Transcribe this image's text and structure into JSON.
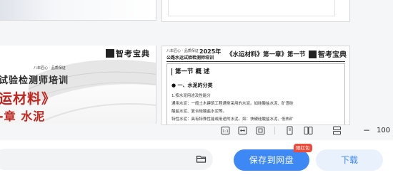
{
  "cover": {
    "brand": "智考宝典",
    "tiny_tag": "八年匠心 · 品质保证",
    "line1": "试验检测师培训",
    "line2": "运材料》",
    "line3": "-章 水泥"
  },
  "text_page": {
    "header_small": "八年匠心 · 品质保证",
    "header_year": "2025年",
    "header_sub": "公路水运试验检测师培训",
    "header_chapter": "《水运材料》第一章》第一节",
    "brand": "智考宝典",
    "section_title": "第一节 概 述",
    "subheading": "一、水泥的分类",
    "paragraphs": [
      "1.按水泥用途及性能分",
      "通用水泥：一般土木建筑工程通常采用的水泥。如硅酸盐水泥、矿渣硅",
      "酸盐水泥、复合硅酸盐水泥等。",
      "特性水泥：具有特殊性能或用途的水泥。如：快硬硅酸盐水泥、低热矿"
    ]
  },
  "toolbar": {
    "icons": [
      "fit-actual-icon",
      "fit-width-icon",
      "fit-page-icon",
      "single-page-icon",
      "two-page-icon",
      "scroll-mode-icon"
    ],
    "zoom_minus": "−",
    "zoom_value": "100"
  },
  "bottom": {
    "save_label": "保存到网盘",
    "badge": "限红包",
    "download_label": "下载"
  },
  "colors": {
    "primary": "#3d88f5",
    "badge_red": "#ef4b3b",
    "cover_red": "#c0231c"
  }
}
